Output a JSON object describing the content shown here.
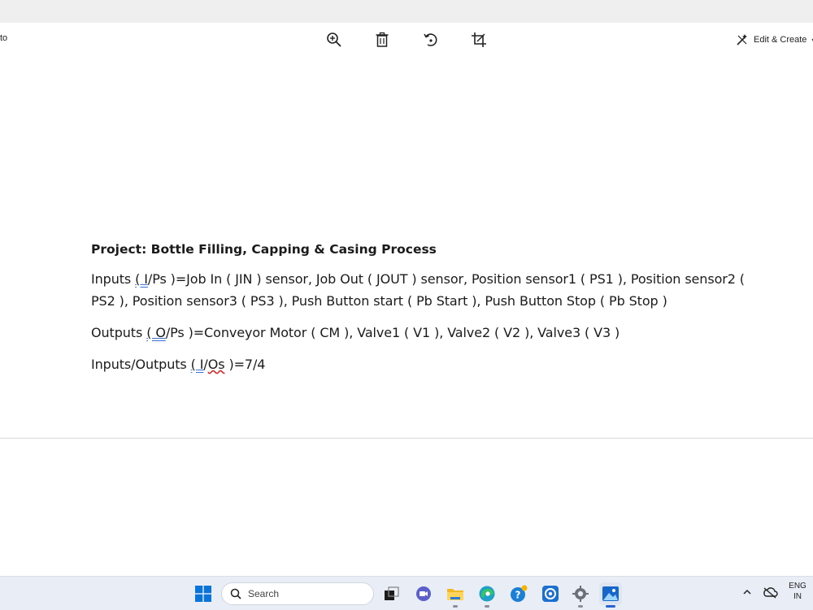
{
  "app": {
    "left_cut_text": "to",
    "toolbar": {
      "zoom_icon": "zoom-in-icon",
      "delete_icon": "trash-icon",
      "rotate_icon": "rotate-icon",
      "crop_icon": "crop-icon",
      "edit_create_label": "Edit & Create"
    }
  },
  "document": {
    "title": "Project: Bottle Filling, Capping & Casing Process",
    "inputs": {
      "prefix": "Inputs ",
      "abbr": "( I",
      "rest": "/Ps )=Job In ( JIN ) sensor, Job Out ( JOUT ) sensor, Position sensor1 ( PS1 ), Position sensor2 ( PS2 ), Position sensor3 ( PS3 ), Push Button start ( Pb Start ), Push Button Stop ( Pb Stop )"
    },
    "outputs": {
      "prefix": "Outputs ",
      "abbr": "( O",
      "rest": "/Ps )=Conveyor Motor ( CM ), Valve1 ( V1 ), Valve2 ( V2 ), Valve3 ( V3 )"
    },
    "io": {
      "prefix": "Inputs/Outputs ",
      "abbr1": "( I",
      "slash": "/",
      "abbr2": "Os",
      "rest": " )=7/4"
    }
  },
  "taskbar": {
    "search_placeholder": "Search",
    "lang_line1": "ENG",
    "lang_line2": "IN",
    "colors": {
      "accent": "#2a62d4",
      "windows_blue": "#0a74da"
    }
  }
}
